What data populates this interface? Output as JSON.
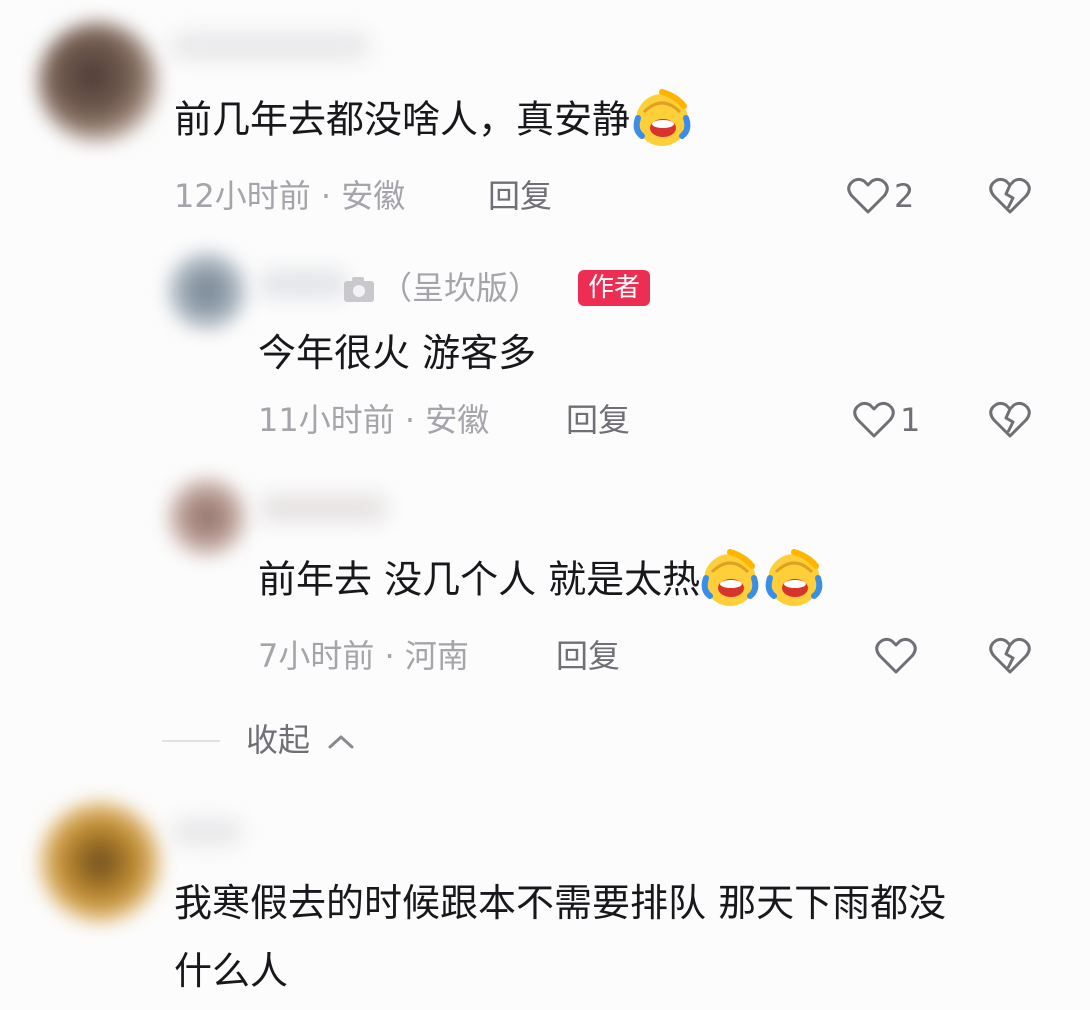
{
  "comments": [
    {
      "text": "前几年去都没啥人，真安静",
      "meta": "12小时前 · 安徽",
      "reply_label": "回复",
      "like_count": "2",
      "emoji": "laughing-crying-emoji"
    }
  ],
  "replies": [
    {
      "nickname_suffix": "（呈坎版）",
      "author_badge": "作者",
      "text": "今年很火 游客多",
      "meta": "11小时前 · 安徽",
      "reply_label": "回复",
      "like_count": "1"
    },
    {
      "text": "前年去 没几个人 就是太热",
      "meta": "7小时前 · 河南",
      "reply_label": "回复",
      "like_count": "",
      "emoji": "laughing-crying-emoji"
    }
  ],
  "collapse": {
    "label": "收起"
  },
  "comment2": {
    "line1": "我寒假去的时候跟本不需要排队 那天下雨都没",
    "line2": "什么人"
  },
  "icons": {
    "like": "heart-outline-icon",
    "dislike": "broken-heart-icon",
    "collapse": "chevron-up-icon",
    "camera": "camera-icon"
  },
  "colors": {
    "badge": "#ee2d53",
    "meta": "#a4a4aa",
    "text": "#18181c"
  }
}
